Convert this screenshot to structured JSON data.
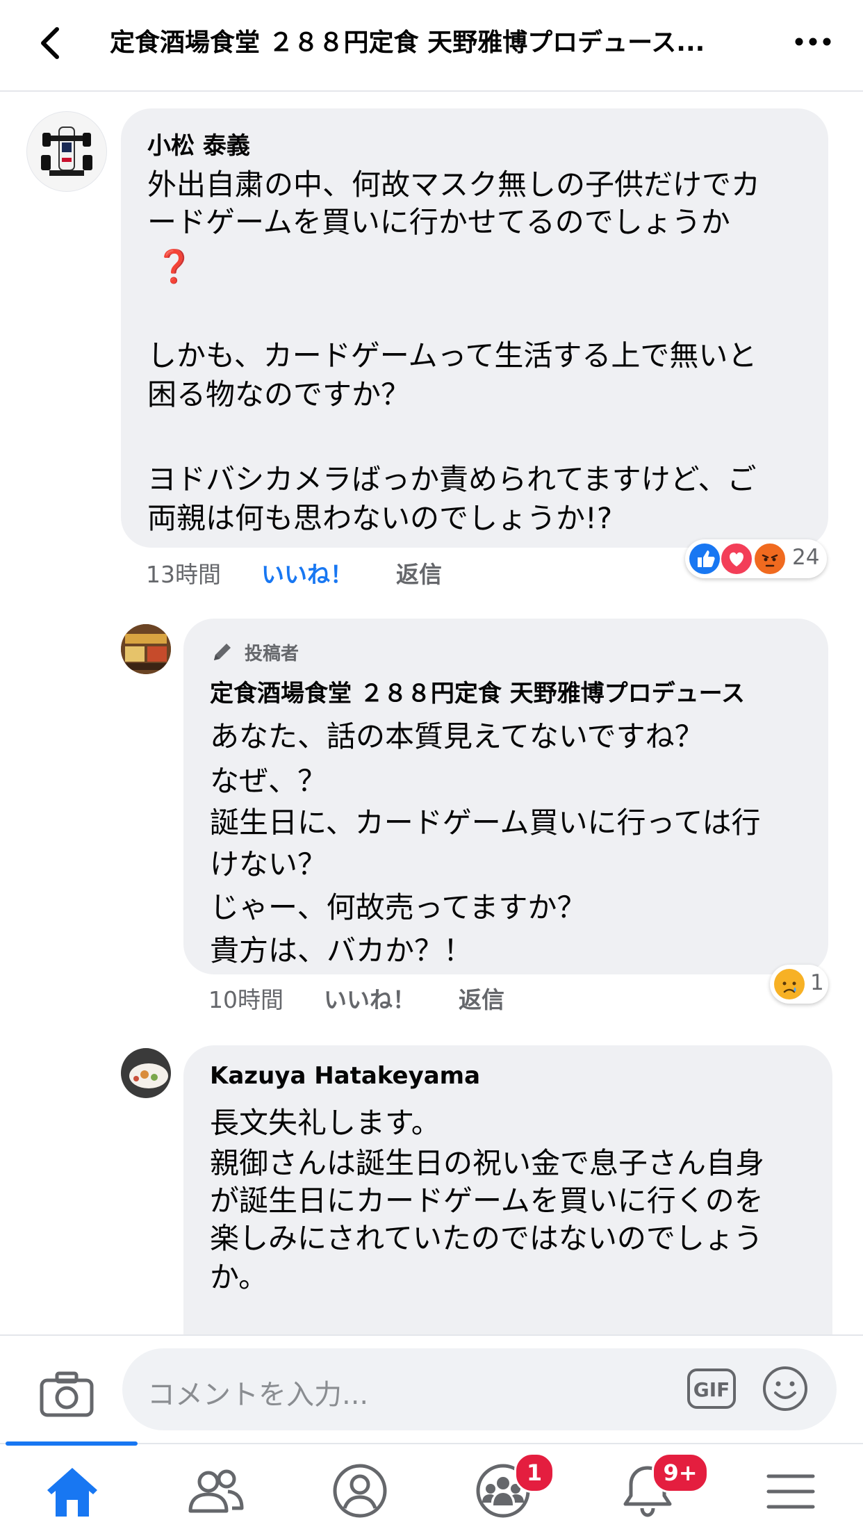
{
  "header": {
    "title": "定食酒場食堂 ２８８円定食 天野雅博プロデュース..."
  },
  "comments": [
    {
      "author": "小松 泰義",
      "lines": [
        "外出自粛の中、何故マスク無しの子供だけでカ",
        "ードゲームを買いに行かせてるのでしょうか",
        "❓",
        "",
        "しかも、カードゲームって生活する上で無いと",
        "困る物なのですか？",
        "",
        "ヨドバシカメラばっか責められてますけど、ご",
        "両親は何も思わないのでしょうか!?"
      ],
      "time": "13時間",
      "like_label": "いいね！",
      "reply_label": "返信",
      "reaction_count": "24"
    },
    {
      "badge_label": "投稿者",
      "author": "定食酒場食堂 ２８８円定食 天野雅博プロデュース",
      "lines": [
        "あなた、話の本質見えてないですね？",
        "なぜ、？",
        "誕生日に、カードゲーム買いに行っては行",
        "けない？",
        "じゃー、何故売ってますか？",
        "貴方は、バカか？！"
      ],
      "time": "10時間",
      "like_label": "いいね！",
      "reply_label": "返信",
      "reaction_count": "1"
    },
    {
      "author": "Kazuya Hatakeyama",
      "lines": [
        "長文失礼します。",
        "親御さんは誕生日の祝い金で息子さん自身",
        "が誕生日にカードゲームを買いに行くのを",
        "楽しみにされていたのではないのでしょう",
        "か。"
      ]
    }
  ],
  "composer": {
    "placeholder": "コメントを入力...",
    "gif_label": "GIF"
  },
  "navbar": {
    "groups_badge": "1",
    "notifications_badge": "9+"
  },
  "colors": {
    "accent": "#1877f2",
    "bubble": "#eff0f3",
    "badge": "#e41e3f"
  }
}
